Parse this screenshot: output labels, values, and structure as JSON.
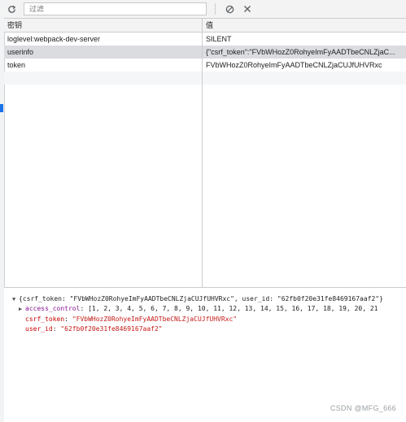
{
  "toolbar": {
    "refresh_icon": "refresh-icon",
    "filter_placeholder": "过滤",
    "clear_icon": "block-icon",
    "delete_icon": "close-icon"
  },
  "table": {
    "columns": [
      "密钥",
      "值"
    ],
    "rows": [
      {
        "key": "loglevel:webpack-dev-server",
        "value": "SILENT"
      },
      {
        "key": "userinfo",
        "value": "{\"csrf_token\":\"FVbWHozZ0RohyeImFyAADTbeCNLZjaC..."
      },
      {
        "key": "token",
        "value": "FVbWHozZ0RohyeImFyAADTbeCNLZjaCUJfUHVRxc"
      }
    ]
  },
  "preview": {
    "line1": "{csrf_token: \"FVbWHozZ0RohyeImFyAADTbeCNLZjaCUJfUHVRxc\", user_id: \"62fb0f20e31fe8469167aaf2\"}",
    "line2_key": "access_control",
    "line2_val": "[1, 2, 3, 4, 5, 6, 7, 8, 9, 10, 11, 12, 13, 14, 15, 16, 17, 18, 19, 20, 21",
    "line3_key": "csrf_token",
    "line3_val": "\"FVbWHozZ0RohyeImFyAADTbeCNLZjaCUJfUHVRxc\"",
    "line4_key": "user_id",
    "line4_val": "\"62fb0f20e31fe8469167aaf2\""
  },
  "watermark": "CSDN @MFG_666"
}
